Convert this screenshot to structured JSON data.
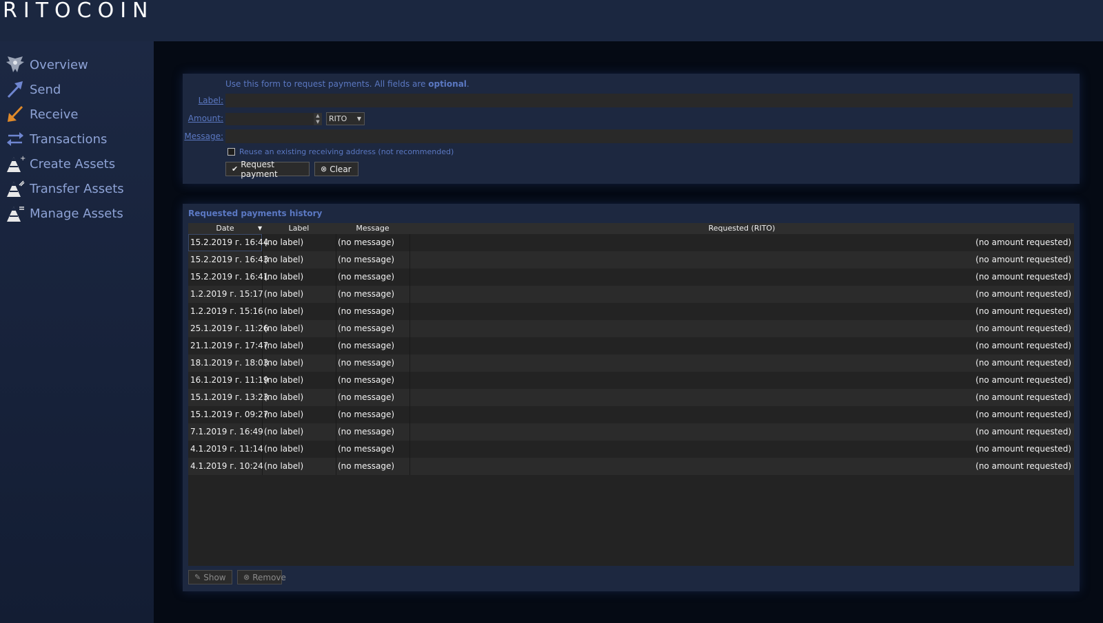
{
  "app": {
    "logo": "RITOCOIN"
  },
  "sidebar": {
    "items": [
      {
        "label": "Overview",
        "icon": "overview-icon"
      },
      {
        "label": "Send",
        "icon": "send-arrow-icon"
      },
      {
        "label": "Receive",
        "icon": "receive-arrow-icon"
      },
      {
        "label": "Transactions",
        "icon": "transactions-icon"
      },
      {
        "label": "Create Assets",
        "icon": "create-assets-icon"
      },
      {
        "label": "Transfer Assets",
        "icon": "transfer-assets-icon"
      },
      {
        "label": "Manage Assets",
        "icon": "manage-assets-icon"
      }
    ]
  },
  "form": {
    "hint_prefix": "Use this form to request payments. All fields are ",
    "hint_bold": "optional",
    "hint_suffix": ".",
    "label_label": "Label:",
    "amount_label": "Amount:",
    "message_label": "Message:",
    "label_value": "",
    "amount_value": "",
    "message_value": "",
    "unit": "RITO",
    "reuse_label": "Reuse an existing receiving address (not recommended)",
    "reuse_checked": false,
    "request_button": "Request payment",
    "clear_button": "Clear"
  },
  "history": {
    "title": "Requested payments history",
    "columns": [
      "Date",
      "Label",
      "Message",
      "Requested (RITO)"
    ],
    "rows": [
      {
        "date": "15.2.2019 г. 16:44",
        "label": "(no label)",
        "message": "(no message)",
        "amount": "(no amount requested)"
      },
      {
        "date": "15.2.2019 г. 16:43",
        "label": "(no label)",
        "message": "(no message)",
        "amount": "(no amount requested)"
      },
      {
        "date": "15.2.2019 г. 16:41",
        "label": "(no label)",
        "message": "(no message)",
        "amount": "(no amount requested)"
      },
      {
        "date": "1.2.2019 г. 15:17",
        "label": "(no label)",
        "message": "(no message)",
        "amount": "(no amount requested)"
      },
      {
        "date": "1.2.2019 г. 15:16",
        "label": "(no label)",
        "message": "(no message)",
        "amount": "(no amount requested)"
      },
      {
        "date": "25.1.2019 г. 11:26",
        "label": "(no label)",
        "message": "(no message)",
        "amount": "(no amount requested)"
      },
      {
        "date": "21.1.2019 г. 17:47",
        "label": "(no label)",
        "message": "(no message)",
        "amount": "(no amount requested)"
      },
      {
        "date": "18.1.2019 г. 18:03",
        "label": "(no label)",
        "message": "(no message)",
        "amount": "(no amount requested)"
      },
      {
        "date": "16.1.2019 г. 11:19",
        "label": "(no label)",
        "message": "(no message)",
        "amount": "(no amount requested)"
      },
      {
        "date": "15.1.2019 г. 13:23",
        "label": "(no label)",
        "message": "(no message)",
        "amount": "(no amount requested)"
      },
      {
        "date": "15.1.2019 г. 09:27",
        "label": "(no label)",
        "message": "(no message)",
        "amount": "(no amount requested)"
      },
      {
        "date": "7.1.2019 г. 16:49",
        "label": "(no label)",
        "message": "(no message)",
        "amount": "(no amount requested)"
      },
      {
        "date": "4.1.2019 г. 11:14",
        "label": "(no label)",
        "message": "(no message)",
        "amount": "(no amount requested)"
      },
      {
        "date": "4.1.2019 г. 10:24",
        "label": "(no label)",
        "message": "(no message)",
        "amount": "(no amount requested)"
      }
    ],
    "show_button": "Show",
    "remove_button": "Remove"
  },
  "colors": {
    "accent_blue": "#5b78c2",
    "nav_text": "#8ea3d6",
    "receive_orange": "#e08a2a"
  }
}
